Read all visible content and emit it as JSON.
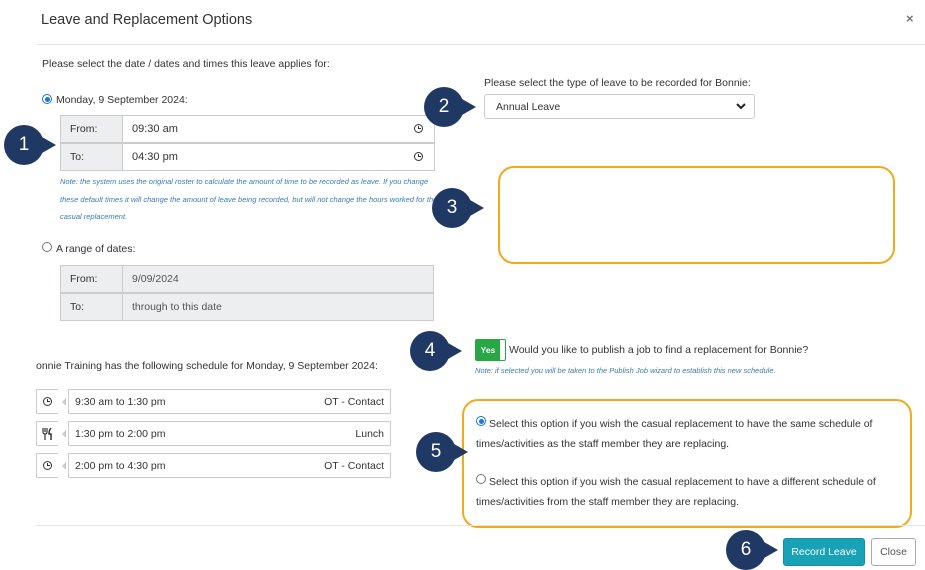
{
  "dialog": {
    "title": "Leave and Replacement Options",
    "close_glyph": "×"
  },
  "dates": {
    "prompt": "Please select the date / dates and times this leave applies for:",
    "single_label": "Monday, 9 September 2024:",
    "from_label": "From:",
    "from_value": "09:30 am",
    "to_label": "To:",
    "to_value": "04:30 pm",
    "note": "Note: the system uses the original roster to calculate the amount of time to be recorded as leave. If you change these default times it will change the amount of leave being recorded, but will not change the hours worked for the casual replacement.",
    "range_label": "A range of dates:",
    "range_from_label": "From:",
    "range_from_value": "9/09/2024",
    "range_to_label": "To:",
    "range_to_placeholder": "through to this date"
  },
  "leave_type": {
    "prompt": "Please select the type of leave to be recorded for Bonnie:",
    "selected": "Annual Leave"
  },
  "publish": {
    "toggle_label": "Yes",
    "question": "Would you like to publish a job to find a replacement for Bonnie?",
    "note": "Note: if selected you will be taken to the Publish Job wizard to establish this new schedule."
  },
  "schedule": {
    "heading": "onnie Training has the following schedule for Monday, 9 September 2024:",
    "rows": [
      {
        "icon": "clock-icon",
        "time": "9:30 am to 1:30 pm",
        "activity": "OT - Contact"
      },
      {
        "icon": "cutlery-icon",
        "time": "1:30 pm to 2:00 pm",
        "activity": "Lunch"
      },
      {
        "icon": "clock-icon",
        "time": "2:00 pm to 4:30 pm",
        "activity": "OT - Contact"
      }
    ]
  },
  "replacement": {
    "same_option": "Select this option if you wish the casual replacement to have the same schedule of times/activities as the staff member they are replacing.",
    "different_option": "Select this option if you wish the casual replacement to have a different schedule of times/activities from the staff member they are replacing."
  },
  "callouts": [
    "1",
    "2",
    "3",
    "4",
    "5",
    "6"
  ],
  "buttons": {
    "record": "Record Leave",
    "close": "Close"
  },
  "colors": {
    "callout_badge": "#1f3864",
    "callout_border": "#f0ab1c",
    "primary_button": "#17a2b8",
    "toggle_green": "#28a745",
    "note_blue": "#3b7ab8"
  }
}
